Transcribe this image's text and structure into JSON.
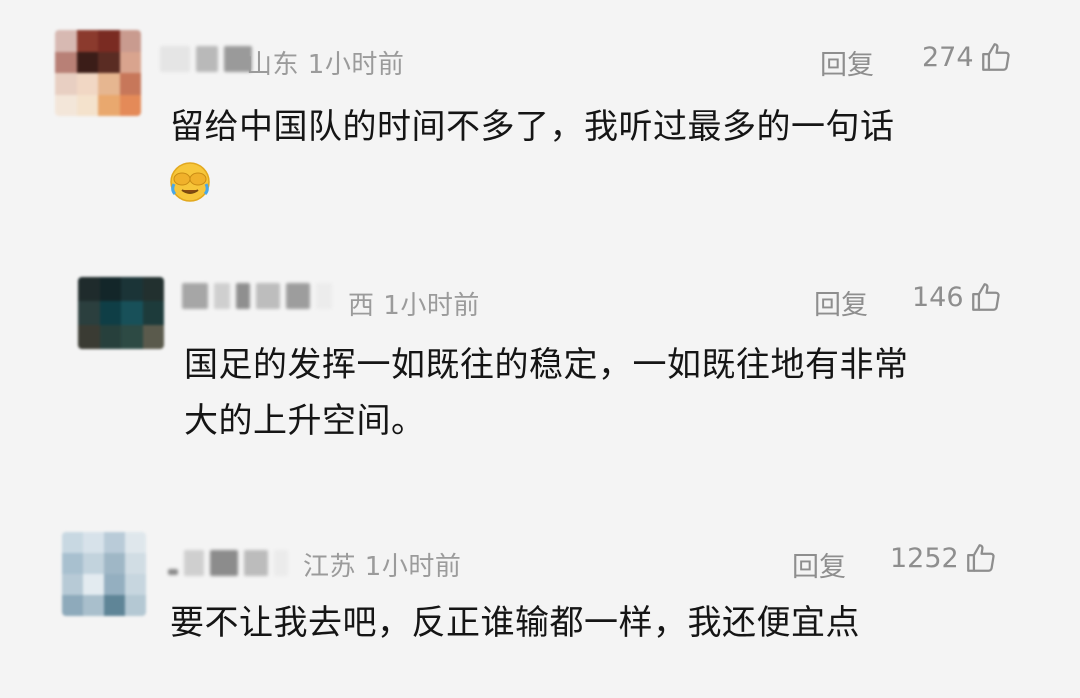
{
  "comments": [
    {
      "location": "山东",
      "time": "1小时前",
      "reply_label": "回复",
      "likes": "274",
      "text_lines": [
        "留给中国队的时间不多了，我听过最多的一句话"
      ],
      "has_emoji": true,
      "emoji_icon": "face-with-tears-covering-eyes-icon"
    },
    {
      "location": "西",
      "time": "1小时前",
      "reply_label": "回复",
      "likes": "146",
      "text_lines": [
        "国足的发挥一如既往的稳定，一如既往地有非常",
        "大的上升空间。"
      ]
    },
    {
      "location": "江苏",
      "time": "1小时前",
      "reply_label": "回复",
      "likes": "1252",
      "text_lines": [
        "要不让我去吧，反正谁输都一样，我还便宜点"
      ]
    }
  ],
  "colors": {
    "meta_text": "#9b9b9b",
    "body_text": "#151515",
    "background": "#f4f4f4"
  }
}
